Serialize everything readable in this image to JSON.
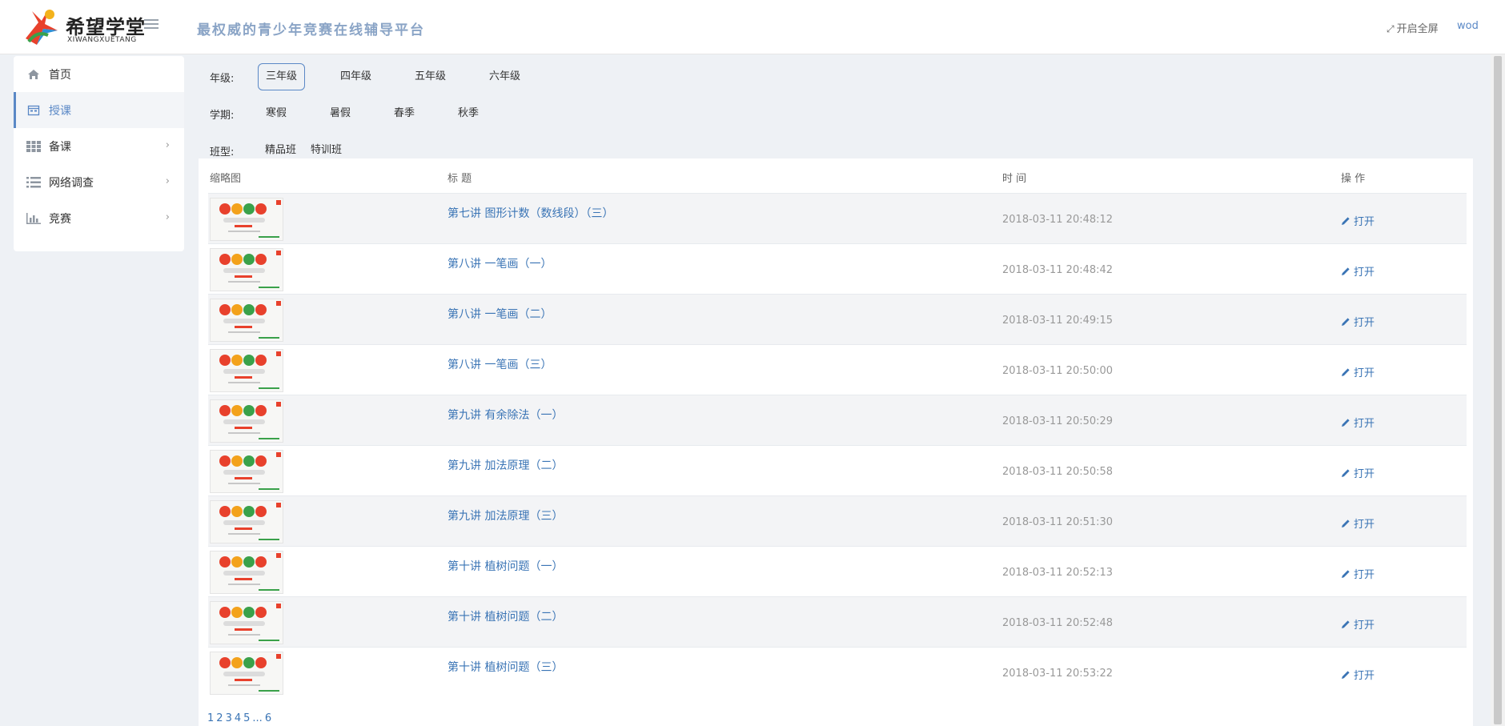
{
  "header": {
    "logo_cn": "希望学堂",
    "logo_en": "XIWANGXUETANG",
    "slogan": "最权威的青少年竞赛在线辅导平台",
    "fullscreen_label": "开启全屏",
    "username": "wod"
  },
  "sidebar": {
    "items": [
      {
        "label": "首页",
        "icon": "home-icon"
      },
      {
        "label": "授课",
        "icon": "calendar-icon",
        "active": true
      },
      {
        "label": "备课",
        "icon": "grid-icon"
      },
      {
        "label": "网络调查",
        "icon": "list-icon"
      },
      {
        "label": "竞赛",
        "icon": "bar-chart-icon"
      }
    ]
  },
  "filters": {
    "grade": {
      "label": "年级:",
      "options": [
        "三年级",
        "四年级",
        "五年级",
        "六年级"
      ],
      "selected": "三年级"
    },
    "term": {
      "label": "学期:",
      "options": [
        "寒假",
        "暑假",
        "春季",
        "秋季"
      ]
    },
    "class_type": {
      "label": "班型:",
      "options": [
        "精品班",
        "特训班"
      ]
    }
  },
  "table": {
    "headers": {
      "thumbnail": "缩略图",
      "title": "标 题",
      "time": "时 间",
      "action": "操 作"
    },
    "rows": [
      {
        "title": "第七讲 图形计数（数线段）（三）",
        "time": "2018-03-11 20:48:12",
        "action": "打开"
      },
      {
        "title": "第八讲 一笔画（一）",
        "time": "2018-03-11 20:48:42",
        "action": "打开"
      },
      {
        "title": "第八讲 一笔画（二）",
        "time": "2018-03-11 20:49:15",
        "action": "打开"
      },
      {
        "title": "第八讲 一笔画（三）",
        "time": "2018-03-11 20:50:00",
        "action": "打开"
      },
      {
        "title": "第九讲 有余除法（一）",
        "time": "2018-03-11 20:50:29",
        "action": "打开"
      },
      {
        "title": "第九讲 加法原理（二）",
        "time": "2018-03-11 20:50:58",
        "action": "打开"
      },
      {
        "title": "第九讲 加法原理（三）",
        "time": "2018-03-11 20:51:30",
        "action": "打开"
      },
      {
        "title": "第十讲 植树问题（一）",
        "time": "2018-03-11 20:52:13",
        "action": "打开"
      },
      {
        "title": "第十讲 植树问题（二）",
        "time": "2018-03-11 20:52:48",
        "action": "打开"
      },
      {
        "title": "第十讲 植树问题（三）",
        "time": "2018-03-11 20:53:22",
        "action": "打开"
      }
    ]
  },
  "pagination": {
    "pages": [
      "1",
      "2",
      "3",
      "4",
      "5",
      "...",
      "6"
    ]
  },
  "colors": {
    "accent": "#5a88c6",
    "link": "#3a74b5",
    "slogan": "#8aa4c6"
  }
}
